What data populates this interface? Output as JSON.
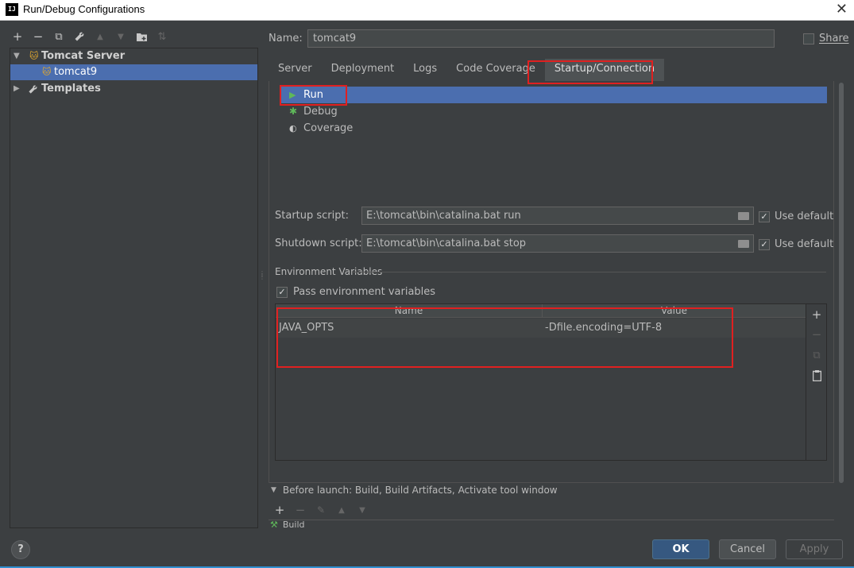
{
  "window": {
    "title": "Run/Debug Configurations",
    "app_icon": "IJ"
  },
  "left_toolbar": [
    {
      "icon": "plus-icon",
      "glyph": "+",
      "enabled": true
    },
    {
      "icon": "minus-icon",
      "glyph": "−",
      "enabled": true
    },
    {
      "icon": "copy-icon",
      "glyph": "⧉",
      "enabled": true
    },
    {
      "icon": "wrench-icon",
      "glyph": "🔧",
      "enabled": true
    },
    {
      "icon": "arrow-up-icon",
      "glyph": "▲",
      "enabled": false
    },
    {
      "icon": "arrow-down-icon",
      "glyph": "▼",
      "enabled": false
    },
    {
      "icon": "folder-add-icon",
      "glyph": "📁",
      "enabled": true
    },
    {
      "icon": "sort-icon",
      "glyph": "⇅",
      "enabled": false
    }
  ],
  "tree": {
    "tomcat_server": "Tomcat Server",
    "tomcat9": "tomcat9",
    "templates": "Templates"
  },
  "name": {
    "label": "Name:",
    "value": "tomcat9"
  },
  "share": {
    "label": "Share",
    "checked": false
  },
  "tabs": [
    {
      "label": "Server",
      "active": false
    },
    {
      "label": "Deployment",
      "active": false
    },
    {
      "label": "Logs",
      "active": false
    },
    {
      "label": "Code Coverage",
      "active": false
    },
    {
      "label": "Startup/Connection",
      "active": true
    }
  ],
  "modes": [
    {
      "label": "Run",
      "icon": "run-icon",
      "selected": true
    },
    {
      "label": "Debug",
      "icon": "bug-icon",
      "selected": false
    },
    {
      "label": "Coverage",
      "icon": "coverage-icon",
      "selected": false
    }
  ],
  "startup": {
    "label": "Startup script:",
    "value": "E:\\tomcat\\bin\\catalina.bat run",
    "use_default_label": "Use default",
    "use_default": true
  },
  "shutdown": {
    "label": "Shutdown script:",
    "value": "E:\\tomcat\\bin\\catalina.bat stop",
    "use_default_label": "Use default",
    "use_default": true
  },
  "env": {
    "section_title": "Environment Variables",
    "pass_label": "Pass environment variables",
    "pass_checked": true,
    "columns": [
      "Name",
      "Value"
    ],
    "rows": [
      {
        "name": "JAVA_OPTS",
        "value": "-Dfile.encoding=UTF-8"
      }
    ]
  },
  "before_launch": {
    "label": "Before launch: Build, Build Artifacts, Activate tool window",
    "items": [
      "Build"
    ]
  },
  "buttons": {
    "help": "?",
    "ok": "OK",
    "cancel": "Cancel",
    "apply": "Apply"
  },
  "colors": {
    "background": "#3c3f41",
    "selection": "#4b6eaf",
    "highlight_box": "#e02020",
    "ok_button": "#365880"
  }
}
